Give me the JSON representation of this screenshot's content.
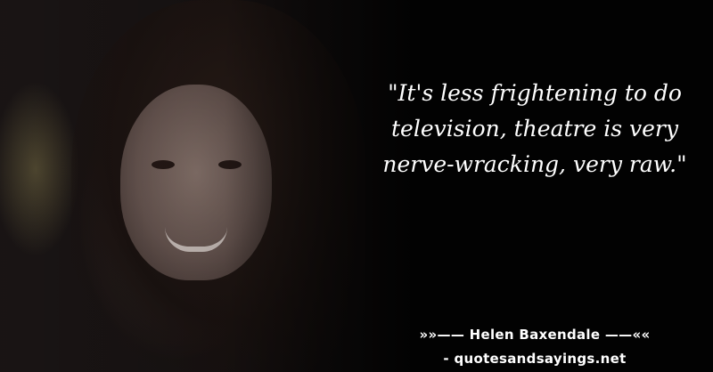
{
  "image": {
    "subject": "portrait photo of a smiling woman with dark hair",
    "background_color": "#020202",
    "text_color": "#ffffff"
  },
  "quote": {
    "text": "\"It's less frightening to do television, theatre is very nerve-wracking, very raw.\""
  },
  "attribution": {
    "text": "»»—— Helen Baxendale ——««"
  },
  "source": {
    "text": "- quotesandsayings.net"
  }
}
